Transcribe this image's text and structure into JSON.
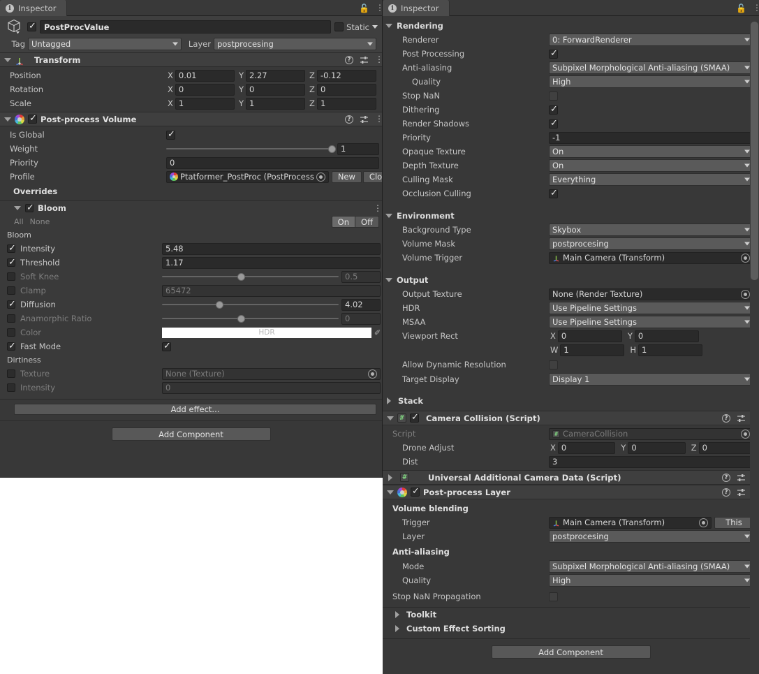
{
  "left": {
    "tab": {
      "label": "Inspector",
      "icon": "info-icon",
      "lock_icon": "lock-open-icon",
      "menu_icon": "kebab-menu-icon"
    },
    "object": {
      "name": "PostProcValue",
      "enabled": true,
      "static_label": "Static",
      "static_checked": false,
      "tag_label": "Tag",
      "tag_value": "Untagged",
      "layer_label": "Layer",
      "layer_value": "postprocesing"
    },
    "transform": {
      "title": "Transform",
      "rows": [
        {
          "label": "Position",
          "x": "0.01",
          "y": "2.27",
          "z": "-0.12"
        },
        {
          "label": "Rotation",
          "x": "0",
          "y": "0",
          "z": "0"
        },
        {
          "label": "Scale",
          "x": "1",
          "y": "1",
          "z": "1"
        }
      ],
      "axis_labels": {
        "x": "X",
        "y": "Y",
        "z": "Z"
      }
    },
    "volume": {
      "title": "Post-process Volume",
      "enabled": true,
      "is_global_label": "Is Global",
      "is_global": true,
      "weight_label": "Weight",
      "weight_value": "1",
      "weight_pct": 100,
      "priority_label": "Priority",
      "priority_value": "0",
      "profile_label": "Profile",
      "profile_value": "Ptatformer_PostProc (PostProcess",
      "new_button": "New",
      "clone_button": "Clone",
      "overrides_label": "Overrides"
    },
    "bloom": {
      "title": "Bloom",
      "enabled": true,
      "all_label": "All",
      "none_label": "None",
      "on_label": "On",
      "off_label": "Off",
      "section_label": "Bloom",
      "dirtiness_label": "Dirtiness",
      "props": [
        {
          "label": "Intensity",
          "checked": true,
          "kind": "field",
          "value": "5.48"
        },
        {
          "label": "Threshold",
          "checked": true,
          "kind": "field",
          "value": "1.17"
        },
        {
          "label": "Soft Knee",
          "checked": false,
          "kind": "slider",
          "value": "0.5",
          "pct": 45
        },
        {
          "label": "Clamp",
          "checked": false,
          "kind": "field",
          "value": "65472"
        },
        {
          "label": "Diffusion",
          "checked": true,
          "kind": "slider",
          "value": "4.02",
          "pct": 33
        },
        {
          "label": "Anamorphic Ratio",
          "checked": false,
          "kind": "slider",
          "value": "0",
          "pct": 45
        },
        {
          "label": "Color",
          "checked": false,
          "kind": "color",
          "value": "HDR"
        },
        {
          "label": "Fast Mode",
          "checked": true,
          "kind": "toggle",
          "value": true
        }
      ],
      "dirt": [
        {
          "label": "Texture",
          "checked": false,
          "kind": "object",
          "value": "None (Texture)"
        },
        {
          "label": "Intensity",
          "checked": false,
          "kind": "field",
          "value": "0"
        }
      ]
    },
    "add_effect_button": "Add effect...",
    "add_component_button": "Add Component"
  },
  "right": {
    "tab": {
      "label": "Inspector",
      "icon": "info-icon",
      "lock_icon": "lock-open-icon",
      "menu_icon": "kebab-menu-icon"
    },
    "rendering": {
      "title": "Rendering",
      "rows": [
        {
          "label": "Renderer",
          "kind": "dropdown",
          "value": "0: ForwardRenderer"
        },
        {
          "label": "Post Processing",
          "kind": "toggle",
          "value": true
        },
        {
          "label": "Anti-aliasing",
          "kind": "dropdown",
          "value": "Subpixel Morphological Anti-aliasing (SMAA)"
        },
        {
          "label": "Quality",
          "kind": "dropdown",
          "value": "High",
          "indent": true
        },
        {
          "label": "Stop NaN",
          "kind": "toggle",
          "value": false
        },
        {
          "label": "Dithering",
          "kind": "toggle",
          "value": true
        },
        {
          "label": "Render Shadows",
          "kind": "toggle",
          "value": true
        },
        {
          "label": "Priority",
          "kind": "field",
          "value": "-1"
        },
        {
          "label": "Opaque Texture",
          "kind": "dropdown",
          "value": "On"
        },
        {
          "label": "Depth Texture",
          "kind": "dropdown",
          "value": "On"
        },
        {
          "label": "Culling Mask",
          "kind": "dropdown",
          "value": "Everything"
        },
        {
          "label": "Occlusion Culling",
          "kind": "toggle",
          "value": true
        }
      ]
    },
    "environment": {
      "title": "Environment",
      "rows": [
        {
          "label": "Background Type",
          "kind": "dropdown",
          "value": "Skybox"
        },
        {
          "label": "Volume Mask",
          "kind": "dropdown",
          "value": "postprocesing"
        },
        {
          "label": "Volume Trigger",
          "kind": "object",
          "value": "Main Camera (Transform)"
        }
      ]
    },
    "output": {
      "title": "Output",
      "rows": [
        {
          "label": "Output Texture",
          "kind": "object",
          "value": "None (Render Texture)"
        },
        {
          "label": "HDR",
          "kind": "dropdown",
          "value": "Use Pipeline Settings"
        },
        {
          "label": "MSAA",
          "kind": "dropdown",
          "value": "Use Pipeline Settings"
        }
      ],
      "viewport_label": "Viewport Rect",
      "viewport": {
        "x_label": "X",
        "x": "0",
        "y_label": "Y",
        "y": "0",
        "w_label": "W",
        "w": "1",
        "h_label": "H",
        "h": "1"
      },
      "allow_dynres_label": "Allow Dynamic Resolution",
      "allow_dynres": false,
      "target_display_label": "Target Display",
      "target_display": "Display 1"
    },
    "stack": {
      "title": "Stack"
    },
    "camera_collision": {
      "title": "Camera Collision (Script)",
      "enabled": true,
      "script_label": "Script",
      "script_value": "CameraCollision",
      "drone_label": "Drone Adjust",
      "drone": {
        "x_label": "X",
        "x": "0",
        "y_label": "Y",
        "y": "0",
        "z_label": "Z",
        "z": "0"
      },
      "dist_label": "Dist",
      "dist_value": "3"
    },
    "ucd": {
      "title": "Universal Additional Camera Data (Script)"
    },
    "pplayer": {
      "title": "Post-process Layer",
      "enabled": true,
      "volume_blending_label": "Volume blending",
      "trigger_label": "Trigger",
      "trigger_value": "Main Camera (Transform)",
      "this_button": "This",
      "layer_label": "Layer",
      "layer_value": "postprocesing",
      "aa_label": "Anti-aliasing",
      "mode_label": "Mode",
      "mode_value": "Subpixel Morphological Anti-aliasing (SMAA)",
      "quality_label": "Quality",
      "quality_value": "High",
      "stopnan_label": "Stop NaN Propagation",
      "stopnan": false,
      "toolkit_label": "Toolkit",
      "custom_effect_label": "Custom Effect Sorting"
    },
    "add_component_button": "Add Component"
  },
  "colors": {
    "panel_bg": "#383838",
    "header_bg": "#3f3f3f",
    "field_bg": "#2a2a2a",
    "dropdown_bg": "#5a5a5a",
    "text": "#c6c6c6",
    "text_dim": "#7e7e7e",
    "accent_script": "#7ed07e"
  }
}
